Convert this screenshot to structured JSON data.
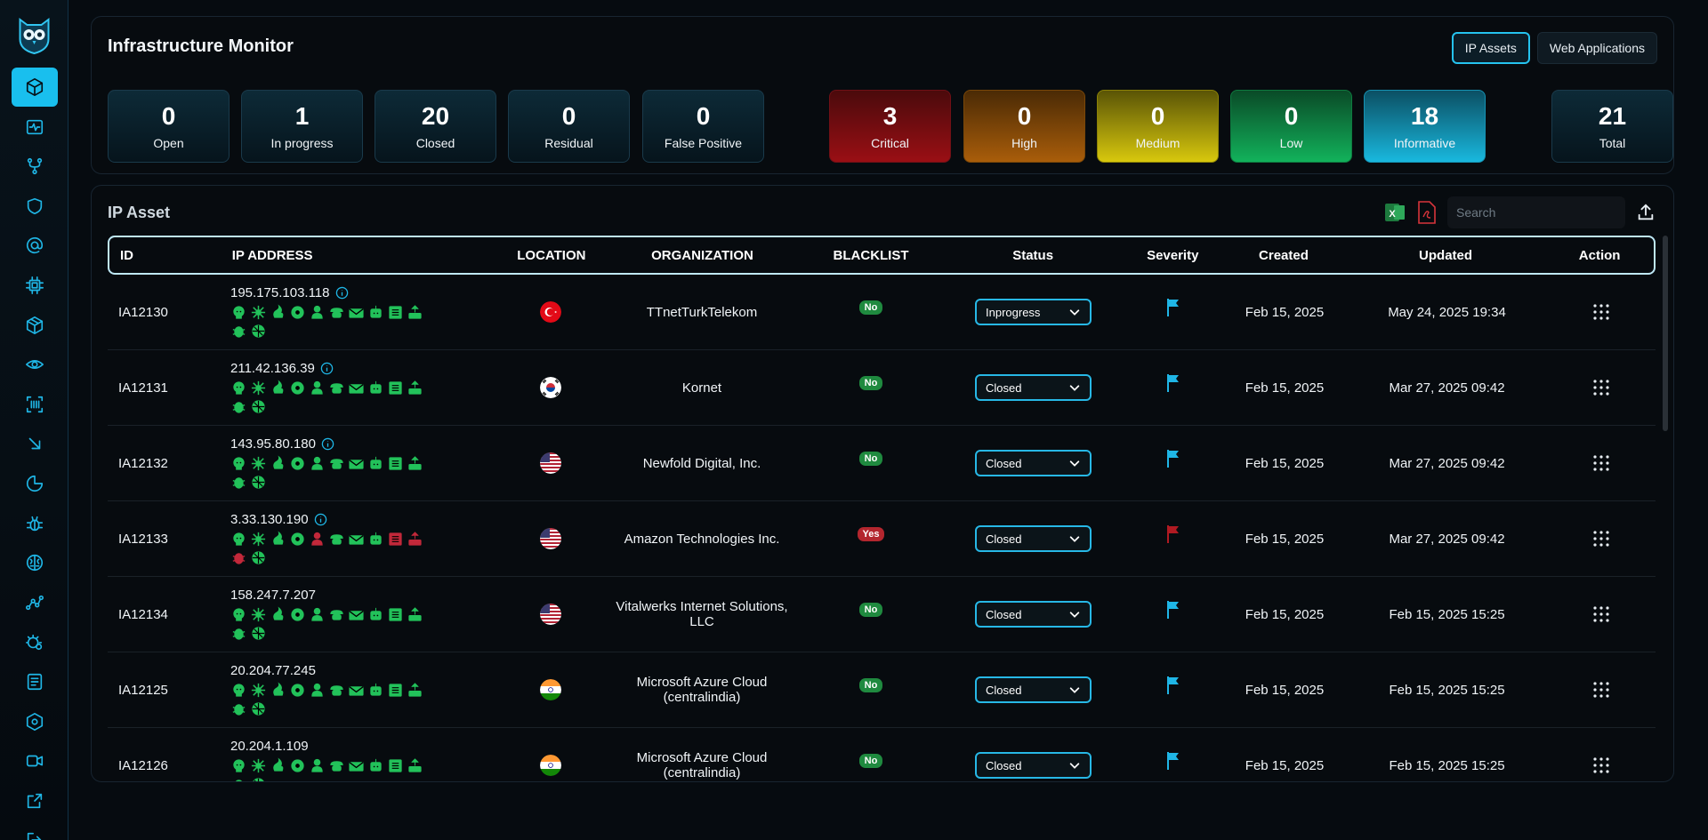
{
  "app": {
    "title": "Infrastructure Monitor",
    "tabs": [
      {
        "label": "IP Assets",
        "active": true
      },
      {
        "label": "Web Applications",
        "active": false
      }
    ]
  },
  "sidebar": {
    "items": [
      {
        "icon": "cube-icon",
        "active": true
      },
      {
        "icon": "activity-icon"
      },
      {
        "icon": "git-branch-icon"
      },
      {
        "icon": "shield-icon"
      },
      {
        "icon": "at-sign-icon"
      },
      {
        "icon": "chip-icon"
      },
      {
        "icon": "box-icon"
      },
      {
        "icon": "eye-icon"
      },
      {
        "icon": "scan-icon"
      },
      {
        "icon": "arrow-down-right-icon"
      },
      {
        "icon": "pie-chart-icon"
      },
      {
        "icon": "bug-icon"
      },
      {
        "icon": "brain-icon"
      },
      {
        "icon": "graph-icon"
      },
      {
        "icon": "settings-bug-icon"
      },
      {
        "icon": "file-text-icon"
      },
      {
        "icon": "hexagon-icon"
      },
      {
        "icon": "video-icon"
      },
      {
        "icon": "external-icon"
      },
      {
        "icon": "logout-icon"
      }
    ]
  },
  "stats": {
    "open": {
      "value": "0",
      "label": "Open"
    },
    "in_progress": {
      "value": "1",
      "label": "In progress"
    },
    "closed": {
      "value": "20",
      "label": "Closed"
    },
    "residual": {
      "value": "0",
      "label": "Residual"
    },
    "false_positive": {
      "value": "0",
      "label": "False Positive"
    },
    "critical": {
      "value": "3",
      "label": "Critical"
    },
    "high": {
      "value": "0",
      "label": "High"
    },
    "medium": {
      "value": "0",
      "label": "Medium"
    },
    "low": {
      "value": "0",
      "label": "Low"
    },
    "informative": {
      "value": "18",
      "label": "Informative"
    },
    "total": {
      "value": "21",
      "label": "Total"
    }
  },
  "table_section": {
    "title": "IP Asset",
    "search_placeholder": "Search",
    "columns": [
      "ID",
      "IP ADDRESS",
      "LOCATION",
      "ORGANIZATION",
      "BLACKLIST",
      "Status",
      "Severity",
      "Created",
      "Updated",
      "Action"
    ],
    "rows": [
      {
        "id": "IA12130",
        "ip": "195.175.103.118",
        "info": true,
        "country": "tr",
        "org": "TTnetTurkTelekom",
        "blacklist": "No",
        "status": "Inprogress",
        "severity": "informative",
        "created": "Feb 15, 2025",
        "updated": "May 24, 2025 19:34"
      },
      {
        "id": "IA12131",
        "ip": "211.42.136.39",
        "info": true,
        "country": "kr",
        "org": "Kornet",
        "blacklist": "No",
        "status": "Closed",
        "severity": "informative",
        "created": "Feb 15, 2025",
        "updated": "Mar 27, 2025 09:42"
      },
      {
        "id": "IA12132",
        "ip": "143.95.80.180",
        "info": true,
        "country": "us",
        "org": "Newfold Digital, Inc.",
        "blacklist": "No",
        "status": "Closed",
        "severity": "informative",
        "created": "Feb 15, 2025",
        "updated": "Mar 27, 2025 09:42"
      },
      {
        "id": "IA12133",
        "ip": "3.33.130.190",
        "info": true,
        "country": "us",
        "org": "Amazon Technologies Inc.",
        "blacklist": "Yes",
        "status": "Closed",
        "severity": "critical",
        "created": "Feb 15, 2025",
        "updated": "Mar 27, 2025 09:42"
      },
      {
        "id": "IA12134",
        "ip": "158.247.7.207",
        "info": false,
        "country": "us",
        "org": "Vitalwerks Internet Solutions, LLC",
        "blacklist": "No",
        "status": "Closed",
        "severity": "informative",
        "created": "Feb 15, 2025",
        "updated": "Feb 15, 2025 15:25"
      },
      {
        "id": "IA12125",
        "ip": "20.204.77.245",
        "info": false,
        "country": "in",
        "org": "Microsoft Azure Cloud (centralindia)",
        "blacklist": "No",
        "status": "Closed",
        "severity": "informative",
        "created": "Feb 15, 2025",
        "updated": "Feb 15, 2025 15:25"
      },
      {
        "id": "IA12126",
        "ip": "20.204.1.109",
        "info": false,
        "country": "in",
        "org": "Microsoft Azure Cloud (centralindia)",
        "blacklist": "No",
        "status": "Closed",
        "severity": "informative",
        "created": "Feb 15, 2025",
        "updated": "Feb 15, 2025 15:25"
      }
    ]
  },
  "colors": {
    "accent": "#19bfee",
    "intel_green": "#22c25a",
    "intel_red": "#c2283a",
    "flag_informative": "#1fb6e6",
    "flag_critical": "#b01a22"
  }
}
